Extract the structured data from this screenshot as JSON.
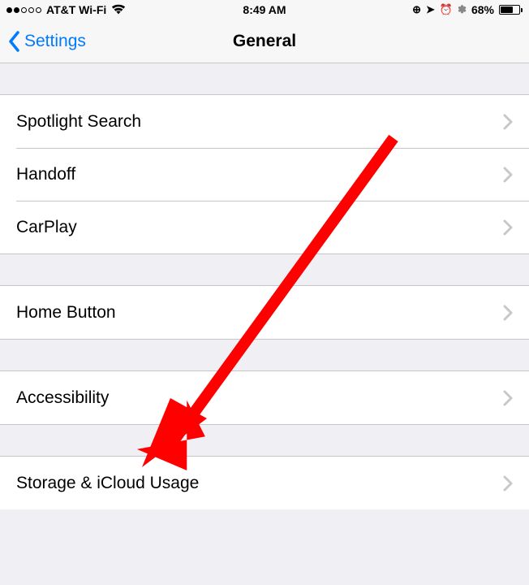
{
  "status": {
    "carrier": "AT&T Wi-Fi",
    "time": "8:49 AM",
    "batteryPercent": "68%"
  },
  "nav": {
    "back": "Settings",
    "title": "General"
  },
  "sections": [
    {
      "items": [
        "Spotlight Search",
        "Handoff",
        "CarPlay"
      ]
    },
    {
      "items": [
        "Home Button"
      ]
    },
    {
      "items": [
        "Accessibility"
      ]
    },
    {
      "items": [
        "Storage & iCloud Usage"
      ]
    }
  ]
}
